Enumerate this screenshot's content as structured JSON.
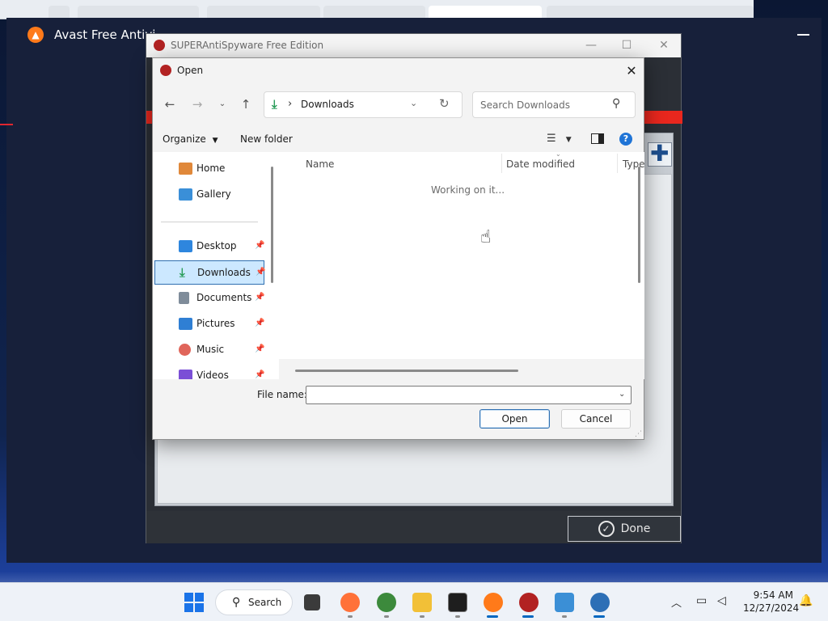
{
  "avast": {
    "title": "Avast Free Antivi"
  },
  "sas": {
    "title": "SUPERAntiSpyware Free Edition",
    "done_label": "Done"
  },
  "dialog": {
    "title": "Open",
    "address": "Downloads",
    "search_placeholder": "Search Downloads",
    "organize_label": "Organize",
    "new_folder_label": "New folder",
    "nav_items": [
      {
        "label": "Home",
        "icon": "home-icon",
        "color": "#e0883a"
      },
      {
        "label": "Gallery",
        "icon": "gallery-icon",
        "color": "#3a8fd8"
      },
      {
        "label": "Desktop",
        "icon": "desktop-icon",
        "color": "#2e86de"
      },
      {
        "label": "Downloads",
        "icon": "download-icon",
        "color": "#2a9d5a"
      },
      {
        "label": "Documents",
        "icon": "documents-icon",
        "color": "#7f8c9a"
      },
      {
        "label": "Pictures",
        "icon": "pictures-icon",
        "color": "#2f7fd4"
      },
      {
        "label": "Music",
        "icon": "music-icon",
        "color": "#e0655a"
      },
      {
        "label": "Videos",
        "icon": "videos-icon",
        "color": "#7b4fd6"
      }
    ],
    "selected_nav": "Downloads",
    "columns": [
      "Name",
      "Date modified",
      "Type"
    ],
    "status": "Working on it...",
    "file_name_label": "File name:",
    "file_name_value": "",
    "open_label": "Open",
    "cancel_label": "Cancel"
  },
  "taskbar": {
    "search_label": "Search",
    "time": "9:54 AM",
    "date": "12/27/2024",
    "apps": [
      {
        "name": "task-view-icon",
        "color": "#3b3b3b"
      },
      {
        "name": "firefox-icon",
        "color": "#ff7139"
      },
      {
        "name": "cybershark-icon",
        "color": "#3c8a3c"
      },
      {
        "name": "file-explorer-icon",
        "color": "#f2c037"
      },
      {
        "name": "terminal-icon",
        "color": "#1e1e1e"
      },
      {
        "name": "avast-icon",
        "color": "#ff7a1a"
      },
      {
        "name": "superantispyware-icon",
        "color": "#b22222"
      },
      {
        "name": "photos-icon",
        "color": "#3b8fd6"
      },
      {
        "name": "globe-app-icon",
        "color": "#2d6fb6"
      }
    ]
  },
  "colors": {
    "accent": "#0067c0",
    "selection": "#cce8ff",
    "sas_red": "#e9271e"
  }
}
